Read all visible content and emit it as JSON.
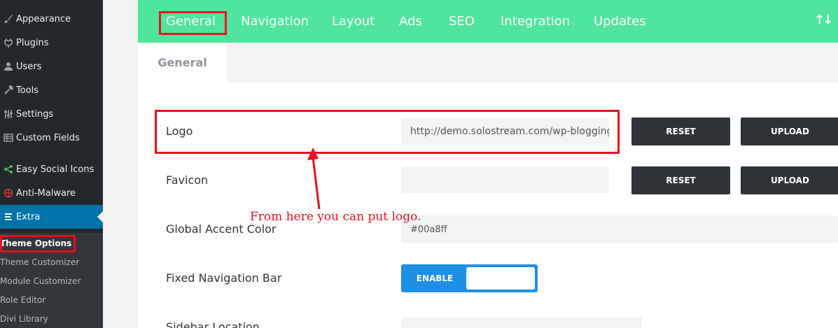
{
  "sidebar": {
    "items": [
      {
        "label": "Appearance",
        "icon": "paintbrush-icon"
      },
      {
        "label": "Plugins",
        "icon": "plug-icon"
      },
      {
        "label": "Users",
        "icon": "user-icon"
      },
      {
        "label": "Tools",
        "icon": "wrench-icon"
      },
      {
        "label": "Settings",
        "icon": "sliders-icon"
      },
      {
        "label": "Custom Fields",
        "icon": "table-icon"
      },
      {
        "label": "Easy Social Icons",
        "icon": "share-icon"
      },
      {
        "label": "Anti-Malware",
        "icon": "shield-icon"
      },
      {
        "label": "Extra",
        "icon": "extra-icon"
      }
    ],
    "submenu": [
      {
        "label": "Theme Options"
      },
      {
        "label": "Theme Customizer"
      },
      {
        "label": "Module Customizer"
      },
      {
        "label": "Role Editor"
      },
      {
        "label": "Divi Library"
      }
    ]
  },
  "tabs": [
    {
      "label": "General"
    },
    {
      "label": "Navigation"
    },
    {
      "label": "Layout"
    },
    {
      "label": "Ads"
    },
    {
      "label": "SEO"
    },
    {
      "label": "Integration"
    },
    {
      "label": "Updates"
    }
  ],
  "subtab": {
    "label": "General"
  },
  "rows": {
    "logo": {
      "label": "Logo",
      "value": "http://demo.solostream.com/wp-blogging"
    },
    "favicon": {
      "label": "Favicon",
      "value": ""
    },
    "accent": {
      "label": "Global Accent Color",
      "value": "#00a8ff"
    },
    "fixed_nav": {
      "label": "Fixed Navigation Bar",
      "toggle_label": "ENABLE"
    },
    "sidebar_location": {
      "label": "Sidebar Location"
    }
  },
  "buttons": {
    "reset": "RESET",
    "upload": "UPLOAD"
  },
  "annotation": {
    "text": "From here you can put logo."
  },
  "colors": {
    "accent_green": "#4fe59c",
    "wp_blue": "#0073aa",
    "annotation_red": "#e8101e",
    "toggle_blue": "#1e8fe6"
  }
}
